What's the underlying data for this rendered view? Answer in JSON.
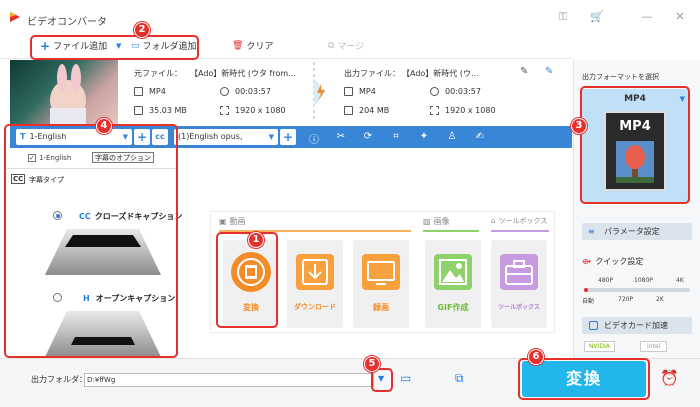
{
  "app": {
    "title": "ビデオコンバータ"
  },
  "toolbar": {
    "add_file": "ファイル追加",
    "add_folder": "フォルダ追加",
    "clear": "クリア",
    "merge": "マージ"
  },
  "file": {
    "source_label": "元ファイル：",
    "source_name": "【Ado】新時代 (ウタ from…",
    "source_format": "MP4",
    "source_duration": "00:03:57",
    "source_size": "35.03 MB",
    "source_resolution": "1920 x 1080",
    "output_label": "出力ファイル：",
    "output_name": "【Ado】新時代 (ウ…",
    "output_format": "MP4",
    "output_duration": "00:03:57",
    "output_size": "204 MB",
    "output_resolution": "1920 x 1080"
  },
  "tracks": {
    "subtitle_selected": "1-English",
    "audio_selected": "(1)English opus,"
  },
  "subtitle_dropdown": {
    "option_1": "1-English",
    "tooltip": "字幕のオプション"
  },
  "subtitle_type": {
    "header": "字幕タイプ",
    "closed_caption": "クローズドキャプション",
    "open_caption": "オープンキャプション"
  },
  "tool_panel": {
    "tabs": [
      "動画",
      "画像",
      "ツールボックス"
    ],
    "cards": [
      "変換",
      "ダウンロード",
      "録画",
      "GIF作成",
      "ツールボックス"
    ]
  },
  "right_panel": {
    "header": "出力フォーマットを選択",
    "format": "MP4",
    "format_icon_text": "MP4",
    "params_button": "パラメータ設定",
    "quick_settings": "クイック設定",
    "quality_top": [
      "480P",
      "1080P",
      "4K"
    ],
    "quality_bottom": [
      "自動",
      "720P",
      "2K"
    ],
    "gpu_accel": "ビデオカード加速",
    "gpu_vendors": [
      "NVIDIA",
      "intel"
    ]
  },
  "bottom": {
    "output_folder_label": "出力フォルダ：",
    "output_folder_value": "D:¥ffWg",
    "convert": "変換"
  },
  "badges": [
    "1",
    "2",
    "3",
    "4",
    "5",
    "6"
  ],
  "colors": {
    "accent_blue": "#3a86d6",
    "convert_blue": "#23b6ea",
    "highlight_red": "#e5302e",
    "orange": "#f28c28",
    "format_bg": "#bfe0f7"
  }
}
